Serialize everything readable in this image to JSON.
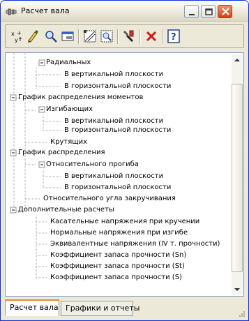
{
  "window": {
    "title": "Расчет вала",
    "app_icon": "shaft-app-icon",
    "controls": [
      "minimize-icon",
      "maximize-icon",
      "close-icon"
    ]
  },
  "toolbar": {
    "buttons": [
      {
        "name": "xy-button",
        "icon": "xy-axes-icon"
      },
      {
        "name": "edit-button",
        "icon": "pencil-icon"
      },
      {
        "name": "search-button",
        "icon": "magnifier-icon"
      },
      {
        "name": "window-button",
        "icon": "panel-icon"
      },
      {
        "name": "diagram-button",
        "icon": "diagram-icon"
      },
      {
        "name": "zoom-region-button",
        "icon": "zoom-region-icon"
      },
      {
        "name": "tools-button",
        "icon": "wrench-icon"
      },
      {
        "name": "delete-button",
        "icon": "red-cross-icon"
      },
      {
        "name": "help-button",
        "icon": "help-icon"
      }
    ]
  },
  "tree": {
    "nodes": [
      {
        "label": "Радиальных",
        "expander": "minus"
      },
      {
        "label": "В вертикальной плоскости"
      },
      {
        "label": "В горизонтальной плоскости"
      },
      {
        "label": "График распределения моментов",
        "expander": "minus"
      },
      {
        "label": "Изгибающих",
        "expander": "minus"
      },
      {
        "label": "В вертикальной плоскости"
      },
      {
        "label": "В горизонтальной плоскости"
      },
      {
        "label": "Крутящих"
      },
      {
        "label": "График распределения",
        "expander": "minus"
      },
      {
        "label": "Относительного прогиба",
        "expander": "minus"
      },
      {
        "label": "В  вертикальной плоскости"
      },
      {
        "label": "В горизонтальной плоскости"
      },
      {
        "label": "Относительного угла закручивания"
      },
      {
        "label": "Дополнительные расчеты",
        "expander": "minus"
      },
      {
        "label": "Касательные напряжения при кручении"
      },
      {
        "label": "Нормальные напряжения при изгибе"
      },
      {
        "label": "Эквивалентные напряжения (IV т. прочности)"
      },
      {
        "label": "Коэффициент запаса прочности (Sn)"
      },
      {
        "label": "Коэффициент запаса прочности (St)"
      },
      {
        "label": "Коэффициент запаса прочности (S)"
      }
    ]
  },
  "tabs": [
    {
      "label": "Расчет вала",
      "active": true
    },
    {
      "label": "Графики и отчеты",
      "active": false
    }
  ],
  "colors": {
    "accent": "#e68b2c",
    "border": "#7f9db9",
    "window_bg": "#ece9d8"
  }
}
